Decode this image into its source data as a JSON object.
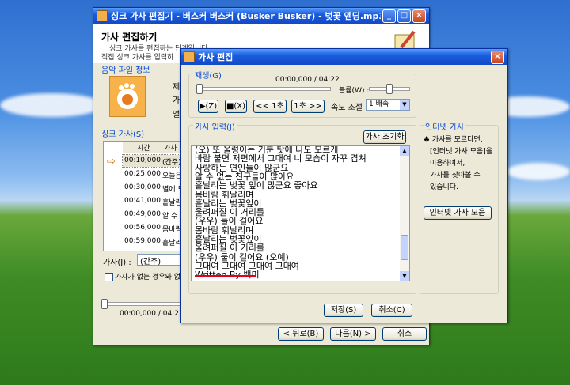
{
  "background_window": {
    "title": "싱크 가사 편집기 - 버스커 버스커 (Busker Busker) - 벚꽃 엔딩.mp3",
    "header": "가사 편집하기",
    "header_sub1": "싱크 가사를 편집하는 단계입니다.",
    "header_sub2": "직접 싱크 가사를 입력하",
    "music_info_label": "음악 파일 정보",
    "info_labels": [
      "제",
      "가",
      "앨"
    ],
    "sync_lyrics_label": "싱크 가사(S)",
    "table_headers": [
      "시간",
      "가사"
    ],
    "rows": [
      {
        "time": "00:10,000",
        "lyric": "(간주)"
      },
      {
        "time": "00:25,000",
        "lyric": "오늘은"
      },
      {
        "time": "00:30,000",
        "lyric": "별에 드"
      },
      {
        "time": "00:41,000",
        "lyric": "흩날린"
      },
      {
        "time": "00:49,000",
        "lyric": "알 수 없"
      },
      {
        "time": "00:56,000",
        "lyric": "몸바람"
      },
      {
        "time": "00:59,000",
        "lyric": "흩날리"
      }
    ],
    "lyric_field_label": "가사(J) :",
    "lyric_field_value": "(간주)",
    "checkbox_label": "가사가 없는 경우와 없",
    "time_display": "00:00,000 / 04:22",
    "back_button": "< 뒤로(B)",
    "next_button": "다음(N) >",
    "cancel_button": "취소"
  },
  "dialog": {
    "title": "가사 편집",
    "play_label": "재생(G)",
    "time_display": "00:00,000 / 04:22",
    "volume_label": "볼륨(W) :",
    "play_button": "▶(Z)",
    "stop_button": "■(X)",
    "rewind_button": "<< 1초",
    "forward_button": "1초 >>",
    "speed_label": "속도 조절 :",
    "speed_value": "1 배속",
    "lyric_input_label": "가사 입력(J)",
    "reset_button": "가사 초기화",
    "lyric_lines": [
      "(오) 또 울렁이는 기분 탓에 나도 모르게",
      "바람 불면 저편에서 그대여 니 모습이 자꾸 겹쳐",
      "사랑하는 연인들이 많군요",
      "알 수 없는 친구들이 많아요",
      "흩날리는 벚꽃 잎이 많군요 좋아요",
      "몸바람 휘날리며",
      "흩날리는 벚꽃잎이",
      "울려퍼질 이 거리를",
      "(우우) 둘이 걸어요",
      "몸바람 휘날리며",
      "흩날리는 벚꽃잎이",
      "울려퍼질 이 거리를",
      "(우우) 둘이 걸어요 (오예)",
      "그대여 그대여 그대여 그대여",
      "Written By 백미"
    ],
    "internet_lyrics_label": "인터넷 가사",
    "internet_desc": [
      "♣ 가사를 모르다면,",
      "[인터넷 가사 모음]을",
      "이용하여서,",
      "가사를 찾아볼 수",
      "있습니다."
    ],
    "internet_button": "인터넷 가사 모음",
    "save_button": "저장(S)",
    "cancel_button": "취소(C)"
  }
}
